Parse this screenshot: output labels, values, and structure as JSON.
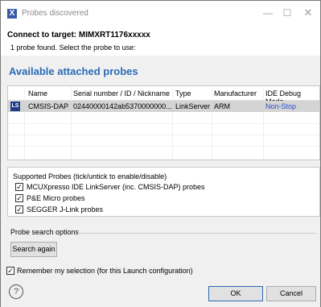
{
  "window": {
    "title": "Probes discovered",
    "min_glyph": "—",
    "max_glyph": "☐",
    "close_glyph": "✕",
    "app_icon": "X"
  },
  "header": {
    "connect_label": "Connect to target: MIMXRT1176xxxxx",
    "found_text": "1 probe found. Select the probe to use:"
  },
  "section_title": "Available attached probes",
  "table": {
    "columns": [
      "Name",
      "Serial number / ID / Nickname",
      "Type",
      "Manufacturer",
      "IDE Debug Mode"
    ],
    "rows": [
      {
        "badge": "LS",
        "name": "CMSIS-DAP",
        "serial": "02440000142ab5370000000...",
        "type": "LinkServer",
        "manufacturer": "ARM",
        "mode": "Non-Stop"
      }
    ]
  },
  "supported": {
    "title": "Supported Probes (tick/untick to enable/disable)",
    "items": [
      {
        "label": "MCUXpresso IDE LinkServer (inc. CMSIS-DAP) probes",
        "checked": true
      },
      {
        "label": "P&E Micro probes",
        "checked": true
      },
      {
        "label": "SEGGER J-Link probes",
        "checked": true
      }
    ]
  },
  "search": {
    "legend": "Probe search options",
    "button_label": "Search again"
  },
  "remember": {
    "label": "Remember my selection (for this Launch configuration)",
    "checked": true
  },
  "footer": {
    "help_glyph": "?",
    "ok_label": "OK",
    "cancel_label": "Cancel"
  },
  "check_glyph": "✓",
  "icons": {
    "app": "app-icon",
    "help": "help-icon",
    "probe": "linkserver-icon"
  },
  "colors": {
    "accent": "#2a6ab4",
    "link": "#2a4bd4",
    "selected_row": "#d4d4d4"
  }
}
